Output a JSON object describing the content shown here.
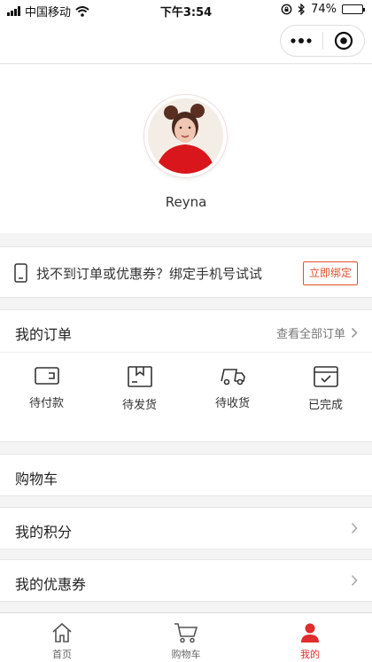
{
  "status_bar": {
    "carrier": "中国移动",
    "time": "下午3:54",
    "battery": "74%",
    "battery_level": 0.74
  },
  "profile": {
    "username": "Reyna"
  },
  "bind_banner": {
    "text": "找不到订单或优惠券？绑定手机号试试",
    "button": "立即绑定"
  },
  "orders": {
    "title": "我的订单",
    "view_all": "查看全部订单",
    "items": [
      {
        "label": "待付款",
        "icon": "wallet-icon"
      },
      {
        "label": "待发货",
        "icon": "package-icon"
      },
      {
        "label": "待收货",
        "icon": "truck-icon"
      },
      {
        "label": "已完成",
        "icon": "completed-icon"
      }
    ]
  },
  "rows": {
    "cart": "购物车",
    "points": "我的积分",
    "coupons": "我的优惠券"
  },
  "tabbar": {
    "items": [
      {
        "label": "首页",
        "icon": "home-icon",
        "active": false
      },
      {
        "label": "购物车",
        "icon": "cart-icon",
        "active": false
      },
      {
        "label": "我的",
        "icon": "user-icon",
        "active": true
      }
    ]
  },
  "colors": {
    "accent": "#e02c2c",
    "bind_button": "#e0502e",
    "background": "#f4f4f4"
  }
}
